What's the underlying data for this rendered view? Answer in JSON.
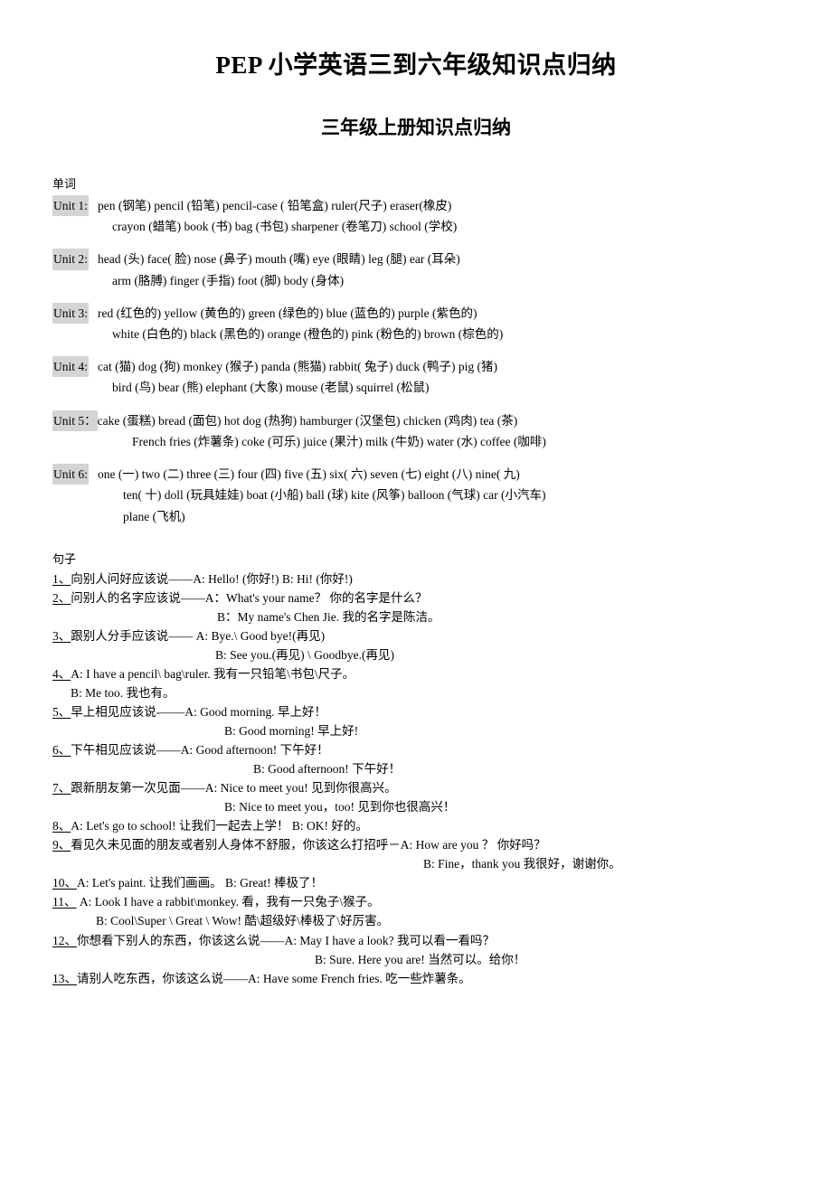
{
  "document": {
    "title": "PEP 小学英语三到六年级知识点归纳",
    "subtitle": "三年级上册知识点归纳"
  },
  "sections": {
    "words": {
      "label": "单词",
      "highlight_color": "#d4d4d4",
      "units": [
        {
          "tag": "Unit 1:",
          "lines": [
            "pen (钢笔)     pencil (铅笔)     pencil-case ( 铅笔盒)  ruler(尺子)    eraser(橡皮)",
            "crayon (蜡笔)    book (书)    bag (书包)     sharpener (卷笔刀)    school (学校)"
          ]
        },
        {
          "tag": "Unit 2:",
          "lines": [
            "head  (头)    face( 脸)  nose (鼻子)     mouth (嘴)   eye (眼睛)    leg (腿)    ear (耳朵)",
            "arm (胳膊)    finger (手指)      foot (脚)    body (身体)"
          ]
        },
        {
          "tag": "Unit 3:",
          "lines": [
            "red (红色的)    yellow (黄色的)     green (绿色的)    blue (蓝色的)    purple (紫色的)",
            "white (白色的)    black (黑色的)    orange (橙色的) pink (粉色的)    brown (棕色的)"
          ]
        },
        {
          "tag": "Unit 4:",
          "lines": [
            "cat (猫)    dog (狗)    monkey (猴子)     panda (熊猫)     rabbit( 兔子) duck (鸭子)     pig (猪)",
            "bird (鸟)    bear (熊)     elephant (大象)     mouse (老鼠)     squirrel (松鼠)"
          ]
        },
        {
          "tag": "Unit 5：",
          "lines": [
            "cake (蛋糕)    bread (面包)    hot dog (热狗)     hamburger (汉堡包)       chicken (鸡肉)   tea (茶)",
            "French fries (炸薯条)    coke (可乐)    juice (果汁)    milk (牛奶)     water (水)       coffee (咖啡)"
          ]
        },
        {
          "tag": "Unit 6:",
          "lines": [
            "one (一)   two (二)      three (三)     four (四)   five (五)    six( 六)   seven (七)   eight (八)   nine( 九)",
            "ten( 十)     doll (玩具娃娃)     boat (小船)   ball (球)   kite (风筝)   balloon (气球)   car (小汽车)",
            "plane (飞机)"
          ]
        }
      ]
    },
    "sentences": {
      "label": "句子",
      "items": [
        {
          "num": "1、",
          "lines": [
            {
              "text": "向别人问好应该说——A: Hello!    (你好!)                 B: Hi!        (你好!)",
              "indent": "none"
            }
          ]
        },
        {
          "num": "2、",
          "lines": [
            {
              "text": "问别人的名字应该说——A：What's your name？          你的名字是什么？",
              "indent": "none"
            },
            {
              "text": "B：My name's Chen Jie.       我的名字是陈洁。",
              "indent": "cont-1"
            }
          ]
        },
        {
          "num": "3、",
          "lines": [
            {
              "text": "跟别人分手应该说—— A: Bye.\\ Good bye!(再见)",
              "indent": "none"
            },
            {
              "text": "B: See you.(再见)   \\ Goodbye.(再见)",
              "indent": "cont-2"
            }
          ]
        },
        {
          "num": "4、",
          "lines": [
            {
              "text": "A: I have a pencil\\ bag\\ruler.    我有一只铅笔\\书包\\尺子。",
              "indent": "none"
            },
            {
              "text": "B: Me too.  我也有。",
              "indent": "cont-3"
            }
          ]
        },
        {
          "num": "5、",
          "lines": [
            {
              "text": "早上相见应该说-——A: Good morning.      早上好！",
              "indent": "none"
            },
            {
              "text": "B: Good morning!      早上好!",
              "indent": "cont-4"
            }
          ]
        },
        {
          "num": "6、",
          "lines": [
            {
              "text": "下午相见应该说——A: Good afternoon!      下午好！",
              "indent": "none"
            },
            {
              "text": "B: Good afternoon!      下午好！",
              "indent": "cont-5"
            }
          ]
        },
        {
          "num": "7、",
          "lines": [
            {
              "text": "跟新朋友第一次见面——A: Nice to meet you!    见到你很高兴。",
              "indent": "none"
            },
            {
              "text": "B: Nice to meet you，too!    见到你也很高兴！",
              "indent": "cont-4"
            }
          ]
        },
        {
          "num": "8、",
          "lines": [
            {
              "text": "A: Let's go to school!   让我们一起去上学！                B: OK!     好的。",
              "indent": "none"
            }
          ]
        },
        {
          "num": "9、",
          "lines": [
            {
              "text": "看见久未见面的朋友或者别人身体不舒服，你该这么打招呼－A: How are you ？    你好吗？",
              "indent": "none"
            },
            {
              "text": "B: Fine，thank you 我很好，谢谢你。",
              "indent": "cont-6"
            }
          ]
        },
        {
          "num": "10、",
          "lines": [
            {
              "text": "A: Let's paint.    让我们画画。              B: Great!       棒极了！",
              "indent": "none"
            }
          ]
        },
        {
          "num": "11、",
          "lines": [
            {
              "text": " A: Look I have a rabbit\\monkey.        看，我有一只兔子\\猴子。",
              "indent": "none"
            },
            {
              "text": "B: Cool\\Super \\ Great \\ Wow!        酷\\超级好\\棒极了\\好厉害。",
              "indent": "cont-7"
            }
          ]
        },
        {
          "num": "12、",
          "lines": [
            {
              "text": "你想看下别人的东西，你该这么说——A: May I have a look?      我可以看一看吗？",
              "indent": "none"
            },
            {
              "text": "B: Sure. Here you are!      当然可以。给你！",
              "indent": "cont-8"
            }
          ]
        },
        {
          "num": "13、",
          "lines": [
            {
              "text": "请别人吃东西，你该这么说——A: Have some French fries.      吃一些炸薯条。",
              "indent": "none"
            }
          ]
        }
      ]
    }
  }
}
